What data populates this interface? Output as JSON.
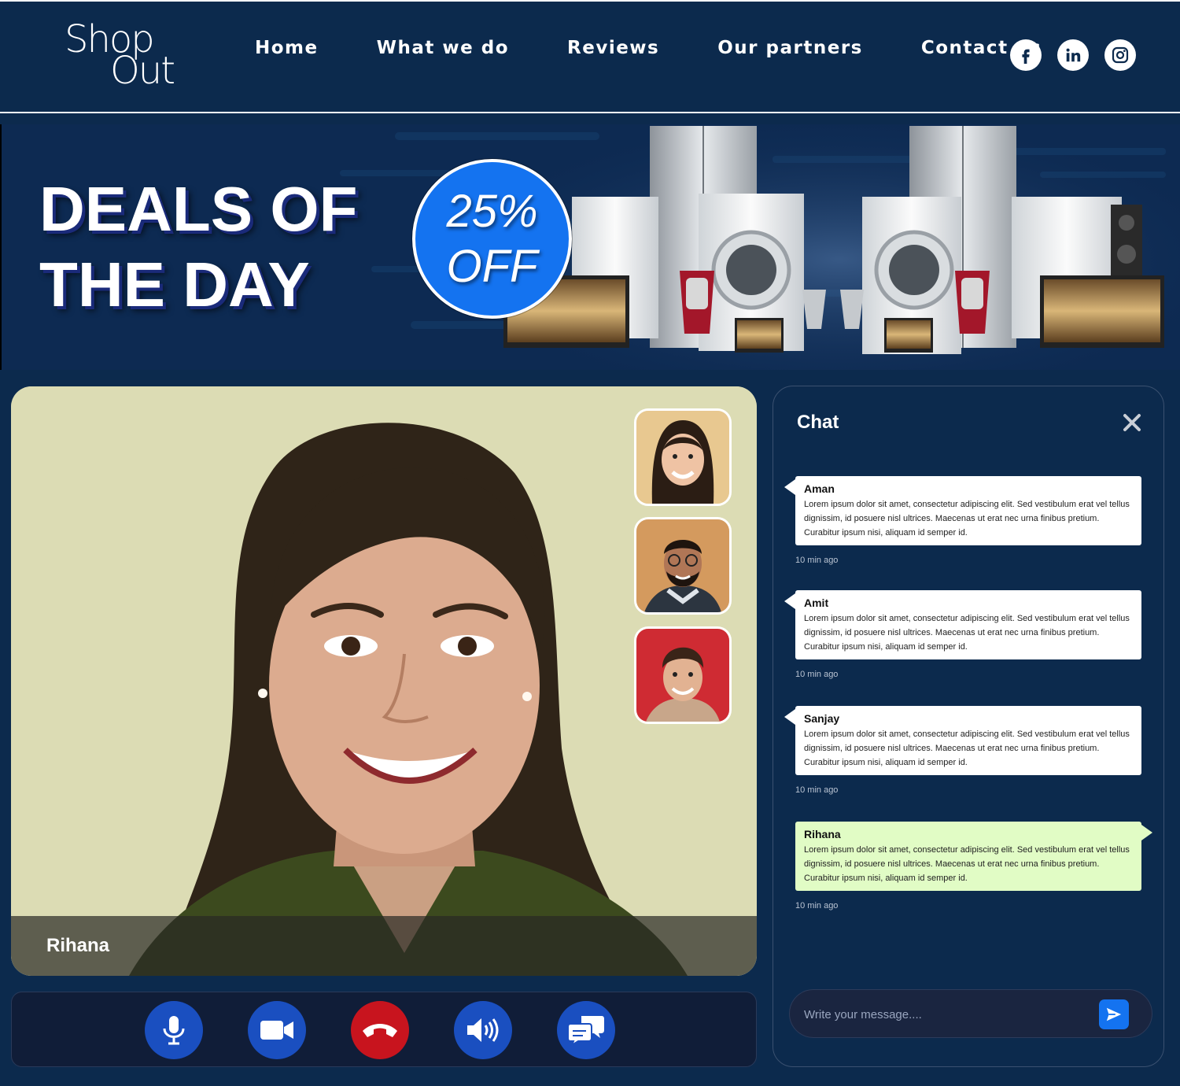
{
  "header": {
    "logo_top": "Shop",
    "logo_bottom": "Out",
    "nav": [
      "Home",
      "What we do",
      "Reviews",
      "Our partners",
      "Contact us"
    ],
    "socials": [
      "facebook-icon",
      "linkedin-icon",
      "instagram-icon"
    ]
  },
  "banner": {
    "title_line1": "DEALS OF",
    "title_line2": "THE DAY",
    "badge_line1": "25%",
    "badge_line2": "OFF"
  },
  "video": {
    "main_participant": "Rihana",
    "thumbnails": [
      "participant-woman",
      "participant-man-glasses",
      "participant-man-red"
    ]
  },
  "controls": [
    "microphone-icon",
    "video-camera-icon",
    "end-call-icon",
    "speaker-icon",
    "chat-bubbles-icon"
  ],
  "chat": {
    "title": "Chat",
    "messages": [
      {
        "name": "Aman",
        "text": "Lorem ipsum dolor sit amet, consectetur adipiscing elit. Sed vestibulum erat vel tellus dignissim, id posuere nisl ultrices. Maecenas ut erat nec urna finibus pretium. Curabitur ipsum nisi, aliquam id semper id.",
        "time": "10 min ago"
      },
      {
        "name": "Amit",
        "text": "Lorem ipsum dolor sit amet, consectetur adipiscing elit. Sed vestibulum erat vel tellus dignissim, id posuere nisl ultrices. Maecenas ut erat nec urna finibus pretium. Curabitur ipsum nisi, aliquam id semper id.",
        "time": "10 min ago"
      },
      {
        "name": "Sanjay",
        "text": "Lorem ipsum dolor sit amet, consectetur adipiscing elit. Sed vestibulum erat vel tellus dignissim, id posuere nisl ultrices. Maecenas ut erat nec urna finibus pretium. Curabitur ipsum nisi, aliquam id semper id.",
        "time": "10 min ago"
      },
      {
        "name": "Rihana",
        "text": "Lorem ipsum dolor sit amet, consectetur adipiscing elit. Sed vestibulum erat vel tellus dignissim, id posuere nisl ultrices. Maecenas ut erat nec urna finibus pretium. Curabitur ipsum nisi, aliquam id semper id.",
        "time": "10 min ago"
      }
    ],
    "input_placeholder": "Write your message...."
  },
  "colors": {
    "background": "#0c2a4d",
    "accent": "#1473f0",
    "end_call": "#c8141e",
    "control_blue": "#1a4fc0",
    "self_message": "#e1fcc5"
  }
}
